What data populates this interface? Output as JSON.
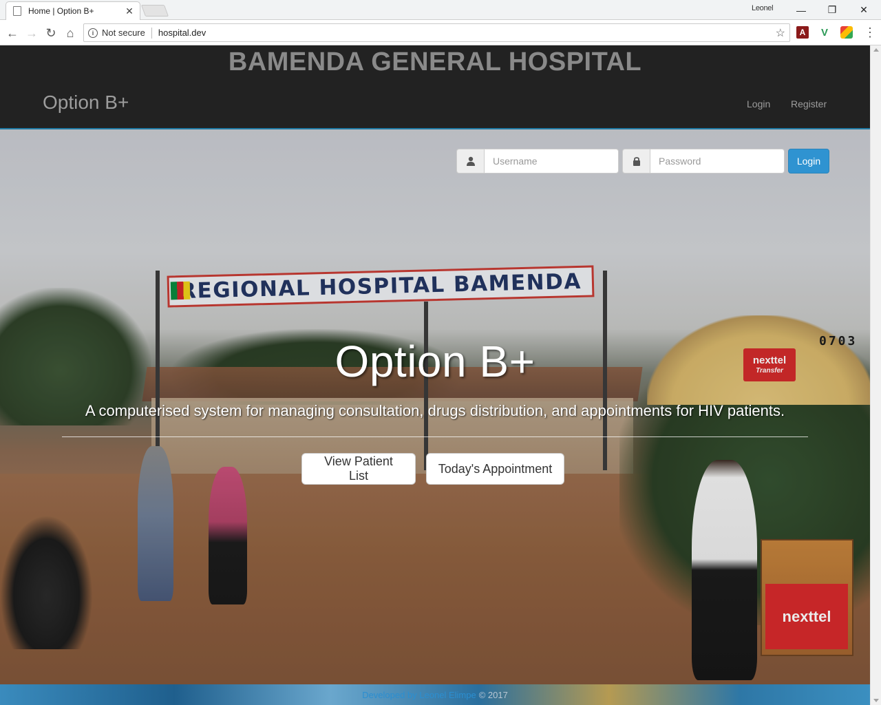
{
  "browser": {
    "tab_title": "Home | Option B+",
    "tab_close": "✕",
    "profile_name": "Leonel",
    "omnibox": {
      "security_label": "Not secure",
      "url": "hospital.dev"
    }
  },
  "header": {
    "hospital_name": "BAMENDA GENERAL HOSPITAL",
    "brand": "Option B+",
    "nav": {
      "login": "Login",
      "register": "Register"
    }
  },
  "login_form": {
    "username_placeholder": "Username",
    "password_placeholder": "Password",
    "submit_label": "Login"
  },
  "hero": {
    "background_sign": "REGIONAL HOSPITAL BAMENDA",
    "umbrella_text": "0703",
    "vendor_brand": "nexttel",
    "vendor_sub": "Transfer",
    "title": "Option B+",
    "subtitle": "A computerised system for managing consultation, drugs distribution, and appointments for HIV patients.",
    "buttons": {
      "patient_list": "View Patient List",
      "appointment": "Today's Appointment"
    }
  },
  "footer": {
    "developer": "Developed by Leonel Elimpe",
    "copyright": "© 2017"
  },
  "colors": {
    "navbar_bg": "#222222",
    "brand_text": "#9d9d9d",
    "login_button": "#2f93d1",
    "footer_link": "#2b8ed0"
  }
}
